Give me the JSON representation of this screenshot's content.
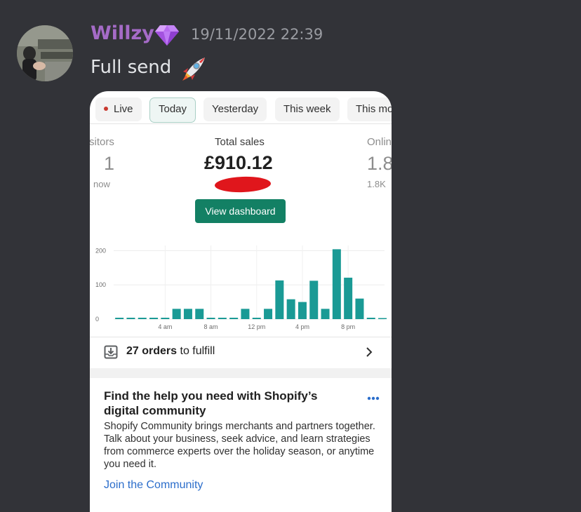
{
  "message": {
    "author": "Willzy",
    "timestamp": "19/11/2022 22:39",
    "text": "Full send",
    "author_color": "#a56bc7",
    "icons": {
      "badge": "diamond-gem-icon",
      "emoji": "rocket-emoji-icon"
    }
  },
  "dashboard": {
    "tabs": [
      "Live",
      "Today",
      "Yesterday",
      "This week",
      "This mo"
    ],
    "active_tab": "Today",
    "stats": {
      "left_label": "sitors",
      "left_value": "1",
      "left_sub": "now",
      "center_label": "Total sales",
      "center_value": "£910.12",
      "right_label": "Onlin",
      "right_value": "1.8",
      "right_sub": "1.8K"
    },
    "view_dashboard_label": "View dashboard",
    "accent_color": "#138064",
    "fulfill": {
      "count": "27 orders",
      "suffix": " to fulfill"
    },
    "card": {
      "title": "Find the help you need with Shopify’s digital community",
      "body": "Shopify Community brings merchants and partners together. Talk about your business, seek advice, and learn strategies from commerce experts over the holiday season, or anytime you need it.",
      "link": "Join the Community"
    }
  },
  "chart_data": {
    "type": "bar",
    "x_tick_labels": [
      "4 am",
      "8 am",
      "12 pm",
      "4 pm",
      "8 pm"
    ],
    "y_tick_labels": [
      "0",
      "100",
      "200"
    ],
    "ylim": [
      0,
      215
    ],
    "hours": [
      0,
      1,
      2,
      3,
      4,
      5,
      6,
      7,
      8,
      9,
      10,
      11,
      12,
      13,
      14,
      15,
      16,
      17,
      18,
      19,
      20,
      21,
      22,
      23
    ],
    "values": [
      2,
      2,
      2,
      2,
      2,
      30,
      30,
      30,
      2,
      2,
      2,
      30,
      2,
      30,
      113,
      58,
      50,
      112,
      30,
      204,
      121,
      60,
      2,
      0
    ],
    "bar_color": "#1a9a95",
    "grid": true
  }
}
